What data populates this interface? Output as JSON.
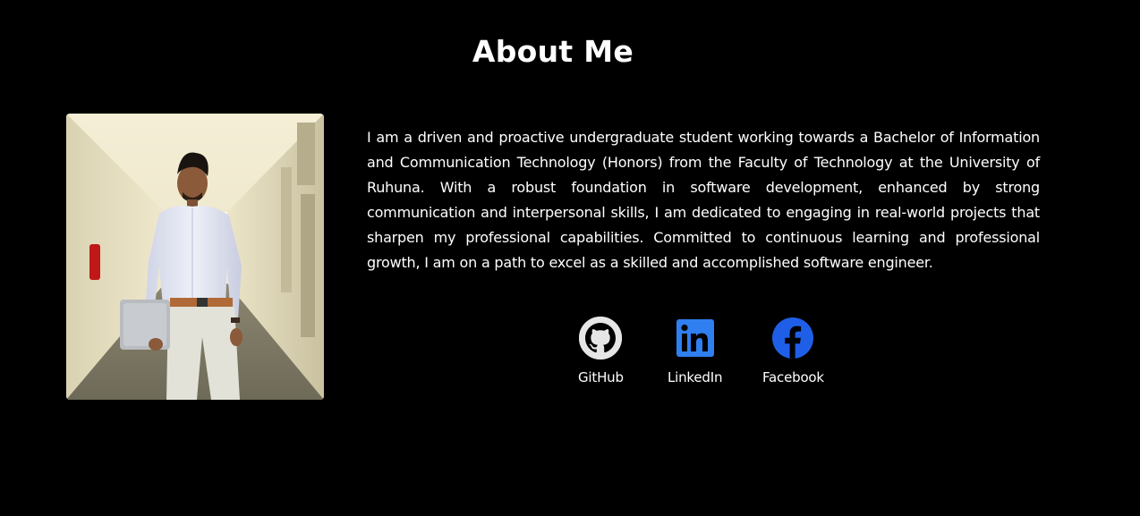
{
  "section": {
    "title": "About Me"
  },
  "bio": {
    "text": "I am a driven and proactive undergraduate student working towards a Bachelor of Information and Communication Technology (Honors) from the Faculty of Technology at the University of Ruhuna. With a robust foundation in software development, enhanced by strong communication and interpersonal skills, I am dedicated to engaging in real-world projects that sharpen my professional capabilities. Committed to continuous learning and professional growth, I am on a path to excel as a skilled and accomplished software engineer."
  },
  "socials": [
    {
      "label": "GitHub",
      "icon": "github-icon",
      "color": "#e6e6e6"
    },
    {
      "label": "LinkedIn",
      "icon": "linkedin-icon",
      "color": "#2f7ff0"
    },
    {
      "label": "Facebook",
      "icon": "facebook-icon",
      "color": "#1f5fe8"
    }
  ],
  "colors": {
    "background": "#000000",
    "text": "#ffffff"
  }
}
